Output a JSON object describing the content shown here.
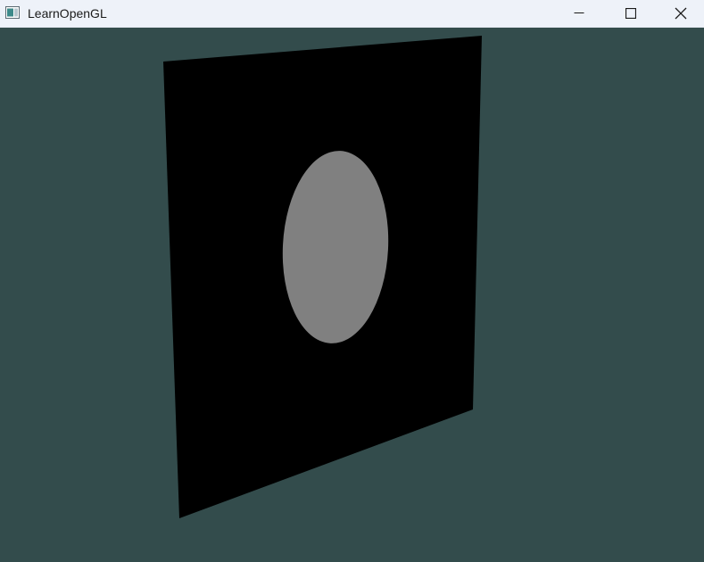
{
  "window": {
    "title": "LearnOpenGL",
    "background_color": "#334c4c",
    "titlebar_color": "#eef2f9",
    "controls": {
      "minimize_icon": "minimize-icon",
      "maximize_icon": "maximize-icon",
      "close_icon": "close-icon"
    }
  },
  "scene": {
    "clear_color": "#334c4c",
    "quad_color": "#000000",
    "ellipse_color": "#808080"
  }
}
